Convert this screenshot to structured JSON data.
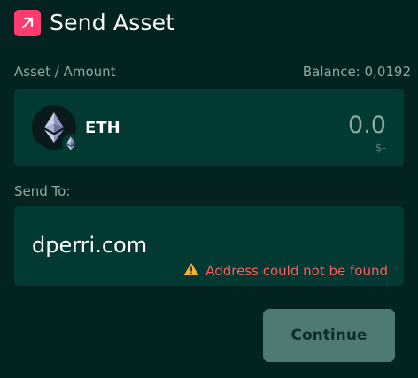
{
  "header": {
    "title": "Send Asset",
    "icon": "arrow-up-right-icon",
    "accent_color": "#ff3b6f"
  },
  "asset_section": {
    "label": "Asset / Amount",
    "balance": "Balance: 0,0192",
    "asset": {
      "symbol": "ETH",
      "icon": "ethereum-icon"
    },
    "amount": "0.0",
    "fiat_value": "$-"
  },
  "send_section": {
    "label": "Send To:",
    "address": "dperri.com",
    "error": {
      "icon": "warning-icon",
      "message": "Address could not be found",
      "color": "#ff5c5c"
    }
  },
  "actions": {
    "continue_label": "Continue"
  }
}
